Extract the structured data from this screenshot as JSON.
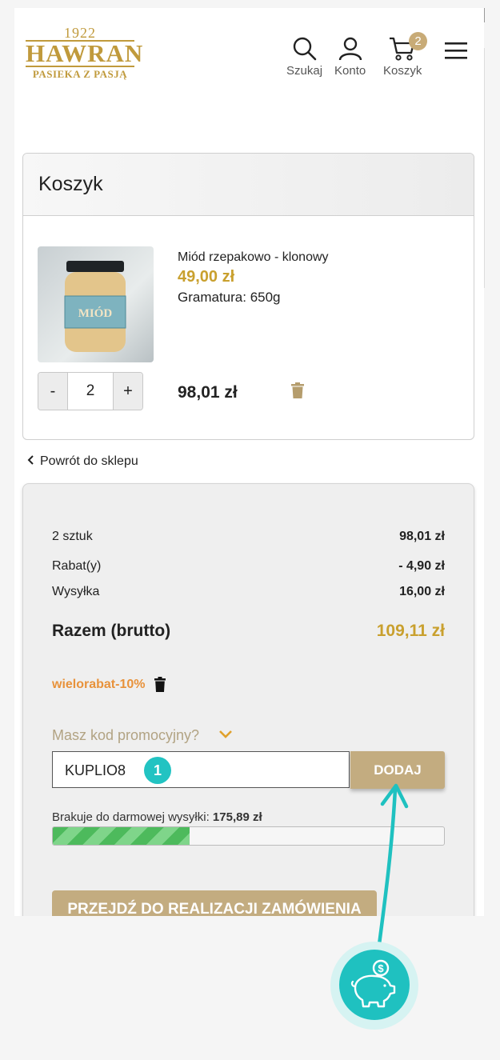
{
  "header": {
    "logo": {
      "year": "1922",
      "brand": "HAWRAN",
      "tagline": "PASIEKA Z PASJĄ"
    },
    "search_label": "Szukaj",
    "account_label": "Konto",
    "cart_label": "Koszyk",
    "cart_count": "2"
  },
  "cart": {
    "title": "Koszyk",
    "item": {
      "name": "Miód rzepakowo - klonowy",
      "price": "49,00 zł",
      "weight": "Gramatura: 650g",
      "qty_minus": "-",
      "qty_value": "2",
      "qty_plus": "+",
      "line_total": "98,01 zł"
    }
  },
  "back_link": "Powrót do sklepu",
  "summary": {
    "items_label": "2 sztuk",
    "items_value": "98,01 zł",
    "discount_label": "Rabat(y)",
    "discount_value": "- 4,90 zł",
    "shipping_label": "Wysyłka",
    "shipping_value": "16,00 zł",
    "total_label": "Razem (brutto)",
    "total_value": "109,11 zł",
    "applied_code": "wielorabat-10%",
    "promo_question": "Masz kod promocyjny?",
    "promo_input_value": "KUPLIO8",
    "promo_button": "DODAJ",
    "free_shipping_label": "Brakuje do darmowej wysyłki:",
    "free_shipping_value": "175,89 zł",
    "free_shipping_progress": 0.35,
    "checkout_button": "PRZEJDŹ DO REALIZACJI ZAMÓWIENIA"
  },
  "overlay": {
    "step_number": "1",
    "coin_icon": "piggy-bank-coin-icon"
  },
  "colors": {
    "gold": "#c9a02e",
    "button": "#c3ac80",
    "accent_teal": "#1fc1c0",
    "orange": "#e8923b"
  }
}
